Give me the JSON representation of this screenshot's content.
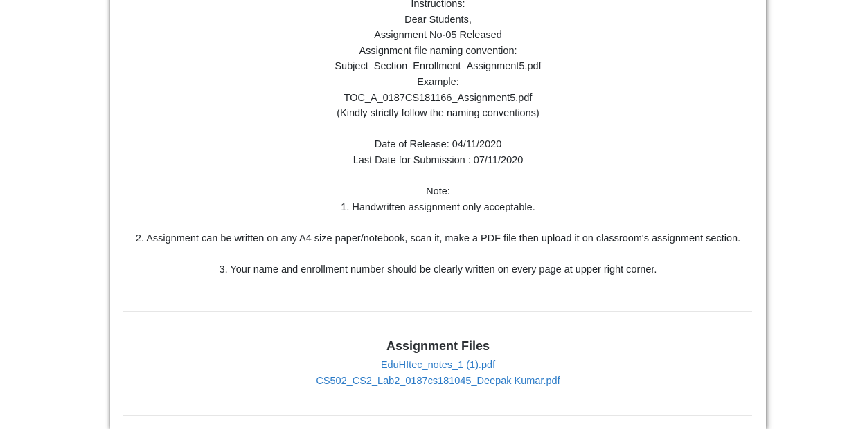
{
  "instructions": {
    "heading": "Instructions:",
    "greeting": "Dear Students,",
    "released": "Assignment No-05 Released",
    "naming_label": "Assignment file naming convention:",
    "naming_pattern": "Subject_Section_Enrollment_Assignment5.pdf",
    "example_label": "Example:",
    "example_value": "TOC_A_0187CS181166_Assignment5.pdf",
    "follow_note": "(Kindly strictly follow the naming conventions)",
    "release_date": "Date of Release: 04/11/2020",
    "last_date": "Last Date for Submission : 07/11/2020",
    "note_label": "Note:",
    "note_1": "1. Handwritten assignment only acceptable.",
    "note_2": "2. Assignment can be written on any A4 size paper/notebook, scan it, make a PDF file then upload it on classroom's assignment section.",
    "note_3": "3. Your name and enrollment number should be clearly written on every page at upper right corner."
  },
  "assignment_files": {
    "title": "Assignment Files",
    "files": [
      "EduHItec_notes_1 (1).pdf",
      "CS502_CS2_Lab2_0187cs181045_Deepak Kumar.pdf"
    ]
  },
  "colors": {
    "link": "#2a7ac7",
    "text": "#212529",
    "divider": "#e6e6e6"
  }
}
